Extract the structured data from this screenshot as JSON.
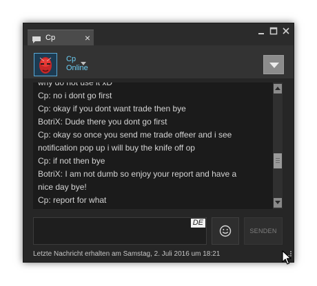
{
  "window": {
    "tab_label": "Cp",
    "tab_close": "×"
  },
  "friend": {
    "name": "Cp",
    "status": "Online"
  },
  "messages": [
    "why do not use it xD",
    "Cp: no i dont go first",
    "Cp: okay if you dont want trade then bye",
    "BotriX: Dude there you dont go first",
    "Cp: okay so once you send me trade offeer and i see",
    "notification pop up i will buy the knife off op",
    "Cp: if not then bye",
    "BotriX: I am not dumb so enjoy your report and have a",
    "nice day bye!",
    "Cp: report for what"
  ],
  "input": {
    "language_badge": "DE",
    "value": ""
  },
  "send_label": "SENDEN",
  "last_message_info": "Letzte Nachricht erhalten am Samstag, 2. Juli 2016 um 18:21",
  "icons": {
    "tab": "chat-bubble-icon",
    "minimize": "minimize-icon",
    "maximize": "maximize-icon",
    "close": "close-icon",
    "dropdown": "chevron-down-icon",
    "menu": "triangle-down-icon",
    "emoji": "smiley-icon"
  },
  "colors": {
    "window_bg": "#262626",
    "header_bg": "#333333",
    "message_bg": "#1b1b1b",
    "friend_online": "#6dcff6",
    "message_text": "#d4d4d4"
  }
}
